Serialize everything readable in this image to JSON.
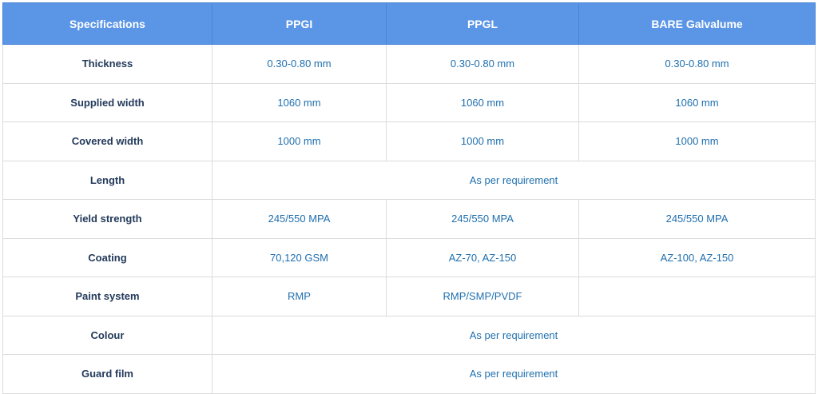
{
  "table": {
    "headers": [
      "Specifications",
      "PPGI",
      "PPGL",
      "BARE Galvalume"
    ],
    "rows": [
      {
        "label": "Thickness",
        "ppgi": "0.30-0.80 mm",
        "ppgl": "0.30-0.80 mm",
        "bare": "0.30-0.80 mm"
      },
      {
        "label": "Supplied width",
        "ppgi": "1060 mm",
        "ppgl": "1060 mm",
        "bare": "1060 mm"
      },
      {
        "label": "Covered width",
        "ppgi": "1000 mm",
        "ppgl": "1000 mm",
        "bare": "1000 mm"
      },
      {
        "label": "Length",
        "merged": "As per requirement"
      },
      {
        "label": "Yield strength",
        "ppgi": "245/550 MPA",
        "ppgl": "245/550 MPA",
        "bare": "245/550 MPA"
      },
      {
        "label": "Coating",
        "ppgi": "70,120 GSM",
        "ppgl": "AZ-70, AZ-150",
        "bare": "AZ-100, AZ-150"
      },
      {
        "label": "Paint system",
        "ppgi": "RMP",
        "ppgl": "RMP/SMP/PVDF",
        "bare": ""
      },
      {
        "label": "Colour",
        "merged": "As per requirement"
      },
      {
        "label": "Guard film",
        "merged": "As per requirement"
      }
    ]
  },
  "colors": {
    "header_bg": "#5b95e6",
    "header_text": "#ffffff",
    "label_text": "#233a5b",
    "value_text": "#1f6fae",
    "grid_line": "#dcdcdc"
  }
}
